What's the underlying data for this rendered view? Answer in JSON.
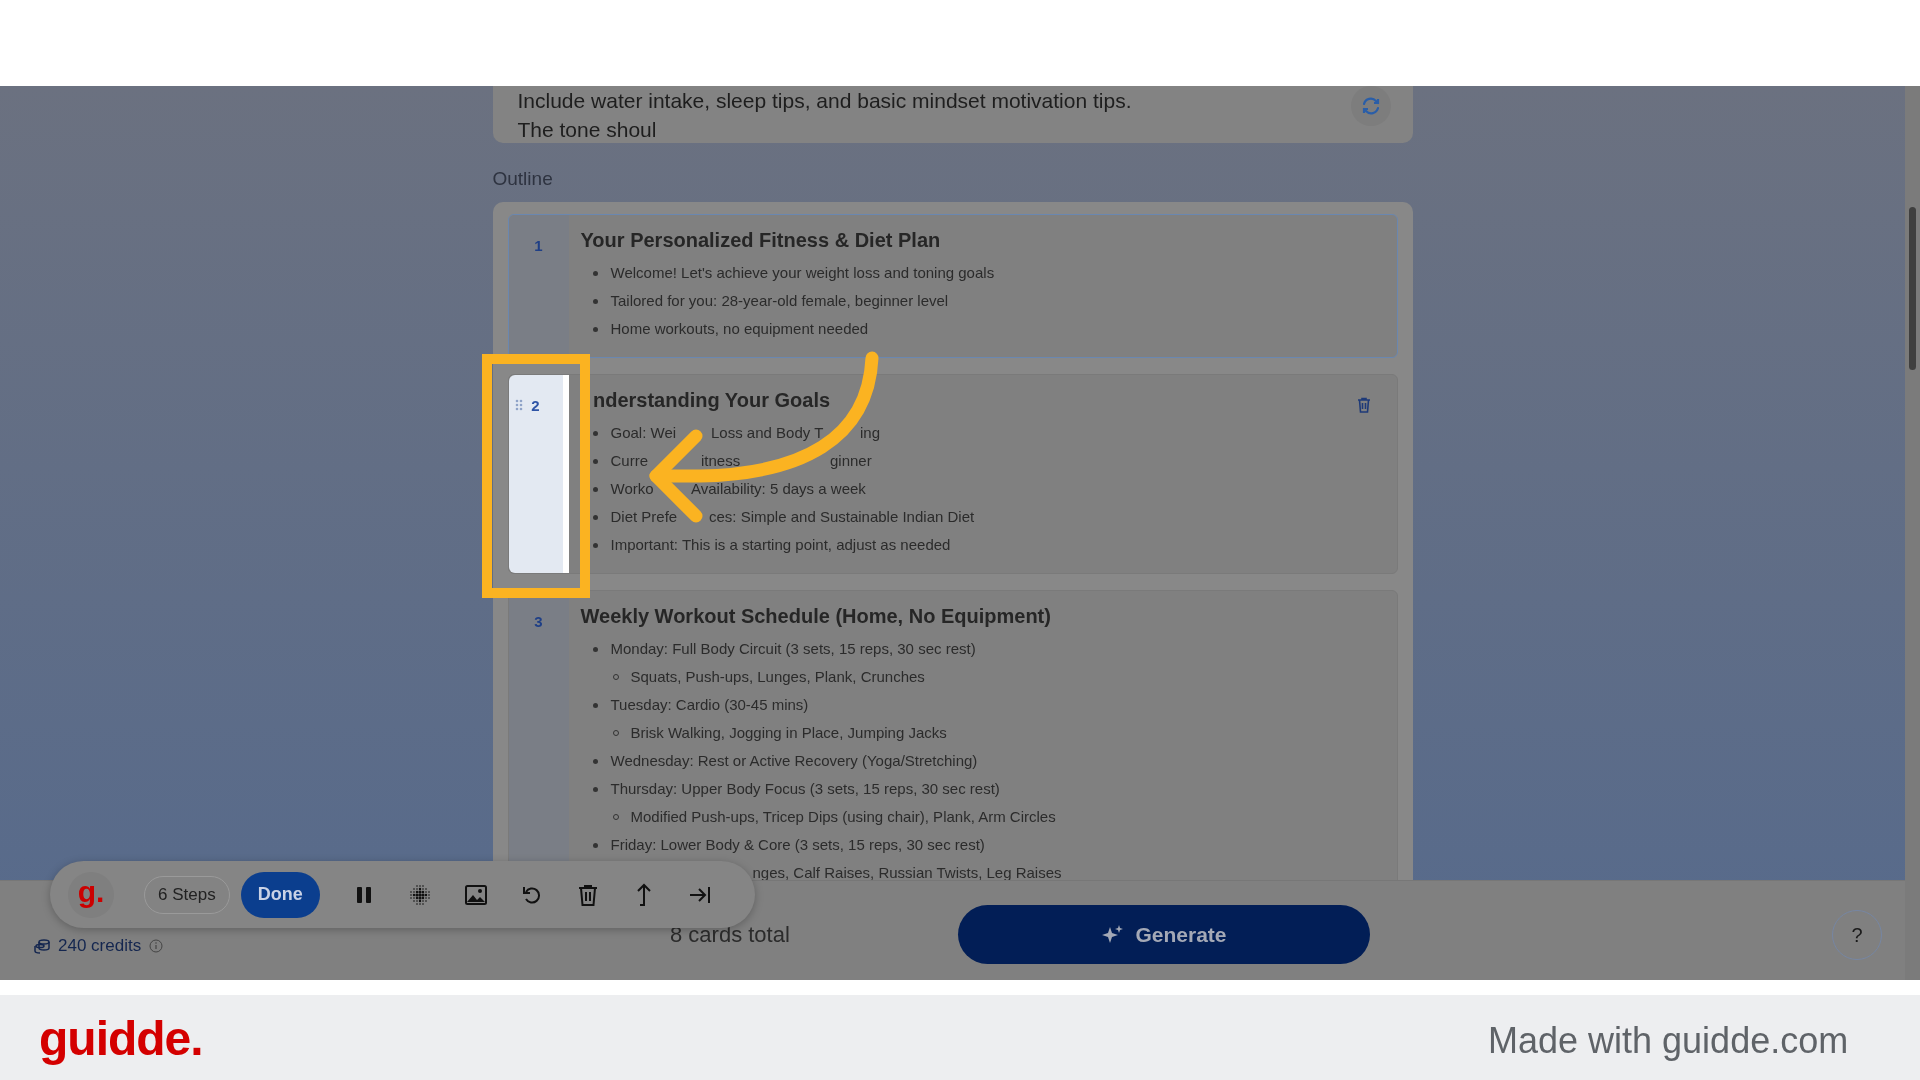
{
  "prompt": {
    "lines": [
      "Include water intake, sleep tips, and basic mindset motivation tips.",
      "The tone shoul"
    ]
  },
  "outline_label": "Outline",
  "cards": [
    {
      "number": "1",
      "title": "Your Personalized Fitness & Diet Plan",
      "focused": true,
      "hovered": false,
      "highlighted": false,
      "items": [
        {
          "text": "Welcome! Let's achieve your weight loss and toning goals"
        },
        {
          "text": "Tailored for you: 28-year-old female, beginner level"
        },
        {
          "text": "Home workouts, no equipment needed"
        }
      ]
    },
    {
      "number": "2",
      "title": "nderstanding Your Goals",
      "focused": false,
      "hovered": true,
      "highlighted": true,
      "items": [
        {
          "parts": [
            "Goal: Wei",
            "Loss and Body T",
            "ing"
          ]
        },
        {
          "parts": [
            "Curre",
            "itness",
            "ginner"
          ]
        },
        {
          "parts": [
            "Worko",
            "Availability: 5 days a week"
          ]
        },
        {
          "parts": [
            "Diet Prefe",
            "ces: Simple and Sustainable Indian Diet"
          ]
        },
        {
          "text": "Important: This is a starting point, adjust as needed"
        }
      ]
    },
    {
      "number": "3",
      "title": "Weekly Workout Schedule (Home, No Equipment)",
      "focused": false,
      "hovered": false,
      "highlighted": false,
      "items": [
        {
          "text": "Monday: Full Body Circuit (3 sets, 15 reps, 30 sec rest)",
          "children": [
            {
              "text": "Squats, Push-ups, Lunges, Plank, Crunches"
            }
          ]
        },
        {
          "text": "Tuesday: Cardio (30-45 mins)",
          "children": [
            {
              "text": "Brisk Walking, Jogging in Place, Jumping Jacks"
            }
          ]
        },
        {
          "text": "Wednesday: Rest or Active Recovery (Yoga/Stretching)"
        },
        {
          "text": "Thursday: Upper Body Focus (3 sets, 15 reps, 30 sec rest)",
          "children": [
            {
              "text": "Modified Push-ups, Tricep Dips (using chair), Plank, Arm Circles"
            }
          ]
        },
        {
          "text": "Friday: Lower Body & Core (3 sets, 15 reps, 30 sec rest)",
          "children": [
            {
              "text": "nges, Calf Raises, Russian Twists, Leg Raises",
              "kind": "partial"
            }
          ]
        }
      ]
    }
  ],
  "bottom_bar": {
    "credits": "240 credits",
    "cards_total": "8 cards total",
    "generate": "Generate",
    "help": "?"
  },
  "toolbar": {
    "logo": "g.",
    "steps": "6 Steps",
    "done": "Done"
  },
  "branding": {
    "logo": "guidde.",
    "tagline": "Made with guidde.com"
  }
}
